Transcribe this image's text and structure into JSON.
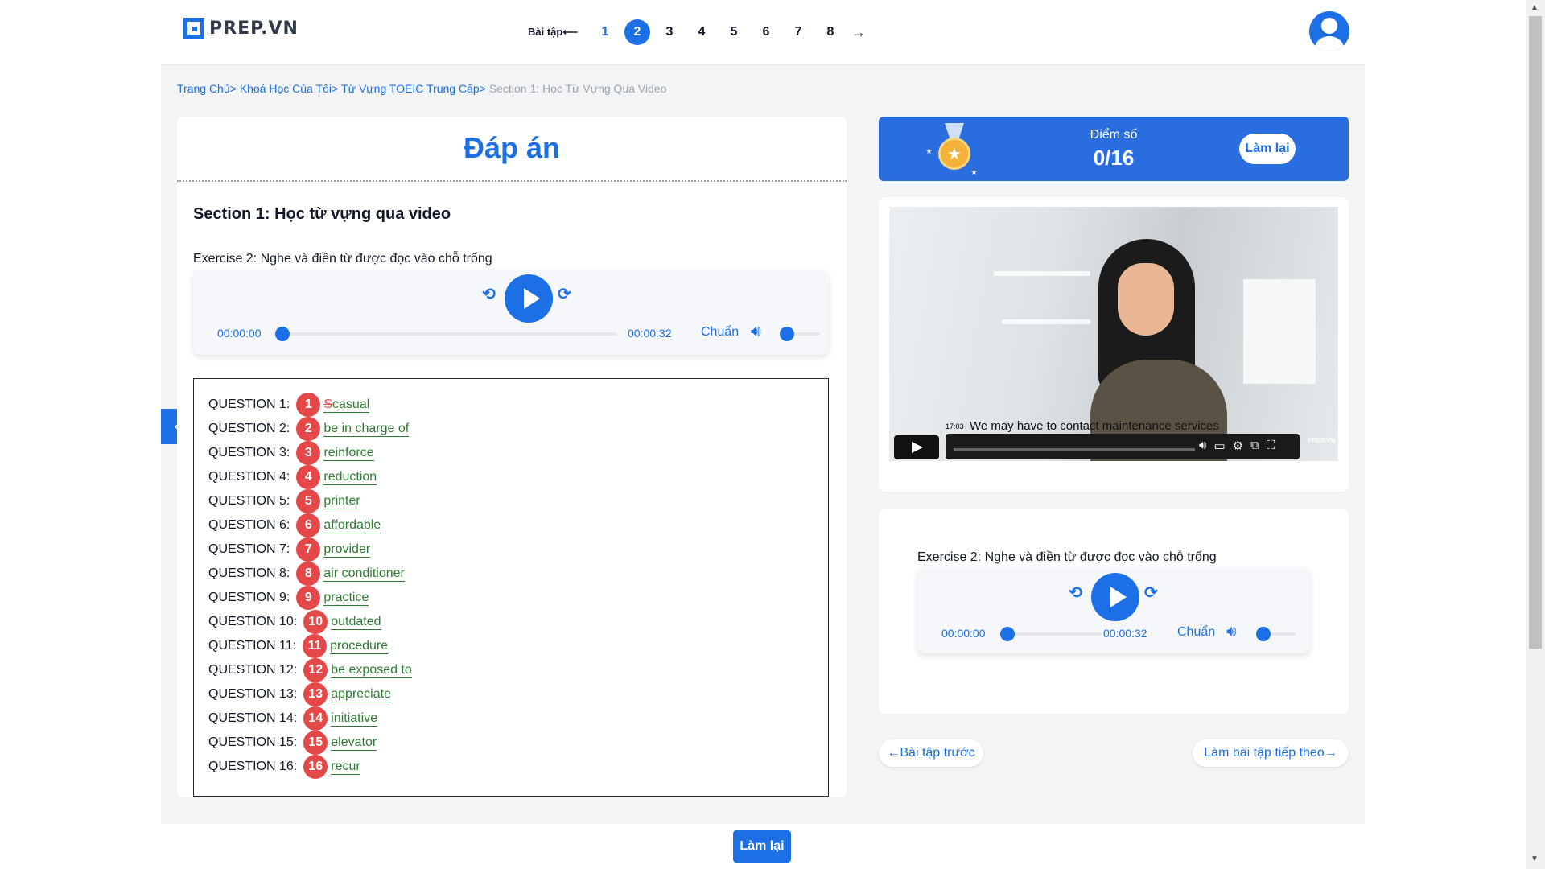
{
  "header": {
    "logo_text": "PREP.VN",
    "pager_label": "Bài tập",
    "pages": [
      "1",
      "2",
      "3",
      "4",
      "5",
      "6",
      "7",
      "8"
    ],
    "active_page": "2",
    "next_arrow": "→"
  },
  "breadcrumb": {
    "items": [
      "Trang Chủ",
      "Khoá Học Của Tôi",
      "Từ Vựng TOEIC Trung Cấp"
    ],
    "separator": ">",
    "current": "Section 1: Học Từ Vựng Qua Video"
  },
  "answer_panel": {
    "title": "Đáp án",
    "section_title": "Section 1: Học từ vựng qua video",
    "exercise_label": "Exercise 2: Nghe và điền từ được đọc vào chỗ trống",
    "questions": [
      {
        "label": "QUESTION 1:",
        "num": "1",
        "wrong": "S",
        "answer": "casual"
      },
      {
        "label": "QUESTION 2:",
        "num": "2",
        "answer": "be in charge of"
      },
      {
        "label": "QUESTION 3:",
        "num": "3",
        "answer": "reinforce"
      },
      {
        "label": "QUESTION 4:",
        "num": "4",
        "answer": "reduction"
      },
      {
        "label": "QUESTION 5:",
        "num": "5",
        "answer": "printer"
      },
      {
        "label": "QUESTION 6:",
        "num": "6",
        "answer": "affordable"
      },
      {
        "label": "QUESTION 7:",
        "num": "7",
        "answer": "provider"
      },
      {
        "label": "QUESTION 8:",
        "num": "8",
        "answer": "air conditioner"
      },
      {
        "label": "QUESTION 9:",
        "num": "9",
        "answer": "practice"
      },
      {
        "label": "QUESTION 10:",
        "num": "10",
        "answer": "outdated"
      },
      {
        "label": "QUESTION 11:",
        "num": "11",
        "answer": "procedure"
      },
      {
        "label": "QUESTION 12:",
        "num": "12",
        "answer": "be exposed to"
      },
      {
        "label": "QUESTION 13:",
        "num": "13",
        "answer": "appreciate"
      },
      {
        "label": "QUESTION 14:",
        "num": "14",
        "answer": "initiative"
      },
      {
        "label": "QUESTION 15:",
        "num": "15",
        "answer": "elevator"
      },
      {
        "label": "QUESTION 16:",
        "num": "16",
        "answer": "recur"
      }
    ]
  },
  "audio_player": {
    "current_time": "00:00:00",
    "duration": "00:00:32",
    "speed_label": "Chuẩn",
    "progress": 0
  },
  "score_card": {
    "label": "Điểm số",
    "value": "0/16",
    "retry_label": "Làm lại"
  },
  "video": {
    "timestamp": "17:03",
    "caption": "We may have to contact maintenance services",
    "brand": "PREP.VN"
  },
  "exercise_card": {
    "exercise_label": "Exercise 2: Nghe và điền từ được đọc vào chỗ trống"
  },
  "navigation": {
    "prev_label": "←Bài tập trước",
    "next_label": "Làm bài tập tiếp theo→"
  },
  "bottom": {
    "retry_label": "Làm lại"
  },
  "colors": {
    "accent": "#1d6fe5",
    "badge": "#e54848",
    "answer": "#2e7d32"
  }
}
